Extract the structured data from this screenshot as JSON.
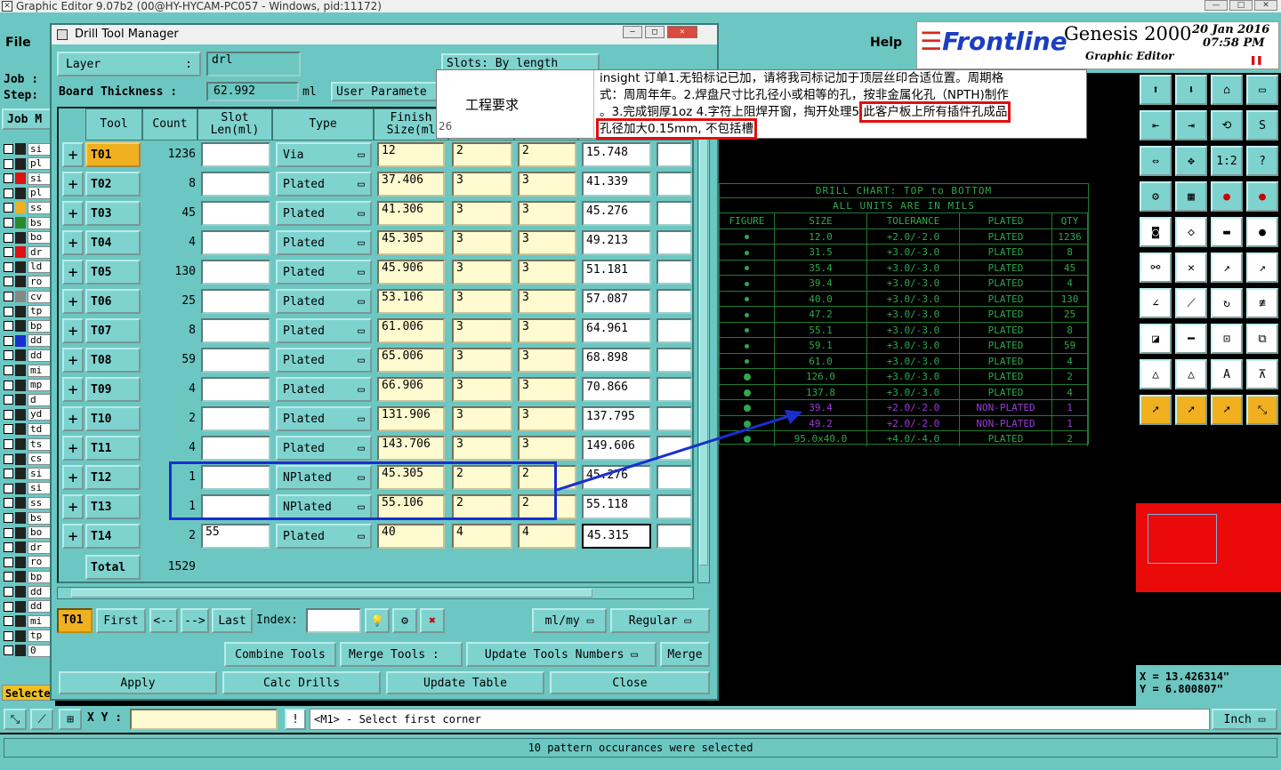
{
  "app": {
    "title": "Graphic Editor 9.07b2 (00@HY-HYCAM-PC057 - Windows, pid:11172)"
  },
  "menu": {
    "file": "File",
    "help": "Help"
  },
  "logo": {
    "brand": "Frontline",
    "product": "Genesis 2000",
    "date_line1": "20 Jan 2016",
    "date_line2": "07:58 PM",
    "subtitle": "Graphic Editor"
  },
  "left": {
    "job_label": "Job :",
    "step_label": "Step:",
    "job_matrix": "Job M",
    "selected": "Selecte",
    "layers": [
      "si",
      "pl",
      "si",
      "pl",
      "ss",
      "bs",
      "bo",
      "dr",
      "ld",
      "ro",
      "cv",
      "tp",
      "bp",
      "dd",
      "dd",
      "mi",
      "mp",
      "d",
      "yd",
      "td",
      "ts",
      "cs",
      "si",
      "si",
      "ss",
      "bs",
      "bo",
      "dr",
      "ro",
      "bp",
      "dd",
      "dd",
      "mi",
      "tp",
      "0"
    ]
  },
  "dialog": {
    "title": "Drill Tool Manager",
    "layer_label": "Layer",
    "layer_sep": ":",
    "layer_value": "drl",
    "slots_label": "Slots:",
    "slots_value": "By length",
    "board_thickness_label": "Board Thickness :",
    "board_thickness_value": "62.992",
    "board_thickness_unit": "ml",
    "user_params": "User Paramete",
    "headers": {
      "tool": "Tool",
      "count": "Count",
      "slot": "Slot\nLen(ml)",
      "type": "Type",
      "finish": "Finish\nSize(ml"
    },
    "rows": [
      {
        "tool": "T01",
        "count": "1236",
        "slot": "",
        "type": "Via",
        "finish": "12",
        "a": "2",
        "b": "2",
        "drill": "15.748"
      },
      {
        "tool": "T02",
        "count": "8",
        "slot": "",
        "type": "Plated",
        "finish": "37.406",
        "a": "3",
        "b": "3",
        "drill": "41.339"
      },
      {
        "tool": "T03",
        "count": "45",
        "slot": "",
        "type": "Plated",
        "finish": "41.306",
        "a": "3",
        "b": "3",
        "drill": "45.276"
      },
      {
        "tool": "T04",
        "count": "4",
        "slot": "",
        "type": "Plated",
        "finish": "45.305",
        "a": "3",
        "b": "3",
        "drill": "49.213"
      },
      {
        "tool": "T05",
        "count": "130",
        "slot": "",
        "type": "Plated",
        "finish": "45.906",
        "a": "3",
        "b": "3",
        "drill": "51.181"
      },
      {
        "tool": "T06",
        "count": "25",
        "slot": "",
        "type": "Plated",
        "finish": "53.106",
        "a": "3",
        "b": "3",
        "drill": "57.087"
      },
      {
        "tool": "T07",
        "count": "8",
        "slot": "",
        "type": "Plated",
        "finish": "61.006",
        "a": "3",
        "b": "3",
        "drill": "64.961"
      },
      {
        "tool": "T08",
        "count": "59",
        "slot": "",
        "type": "Plated",
        "finish": "65.006",
        "a": "3",
        "b": "3",
        "drill": "68.898"
      },
      {
        "tool": "T09",
        "count": "4",
        "slot": "",
        "type": "Plated",
        "finish": "66.906",
        "a": "3",
        "b": "3",
        "drill": "70.866"
      },
      {
        "tool": "T10",
        "count": "2",
        "slot": "",
        "type": "Plated",
        "finish": "131.906",
        "a": "3",
        "b": "3",
        "drill": "137.795"
      },
      {
        "tool": "T11",
        "count": "4",
        "slot": "",
        "type": "Plated",
        "finish": "143.706",
        "a": "3",
        "b": "3",
        "drill": "149.606"
      },
      {
        "tool": "T12",
        "count": "1",
        "slot": "",
        "type": "NPlated",
        "finish": "45.305",
        "a": "2",
        "b": "2",
        "drill": "45.276"
      },
      {
        "tool": "T13",
        "count": "1",
        "slot": "",
        "type": "NPlated",
        "finish": "55.106",
        "a": "2",
        "b": "2",
        "drill": "55.118"
      },
      {
        "tool": "T14",
        "count": "2",
        "slot": "55",
        "type": "Plated",
        "finish": "40",
        "a": "4",
        "b": "4",
        "drill": "45.315"
      }
    ],
    "total_label": "Total",
    "total_value": "1529",
    "nav": {
      "current": "T01",
      "first": "First",
      "prev": "<--",
      "next": "-->",
      "last": "Last",
      "index": "Index:",
      "units": "ml/my",
      "mode": "Regular"
    },
    "actions": {
      "combine": "Combine Tools",
      "merge_label": "Merge Tools :",
      "update_numbers": "Update Tools Numbers",
      "merge": "Merge",
      "apply": "Apply",
      "calc": "Calc Drills",
      "update_table": "Update Table",
      "close": "Close"
    }
  },
  "popup": {
    "line_no": "26",
    "label": "工程要求",
    "text1": "insight 订单1.无铅标记已加，请将我司标记加于顶层丝印合适位置。周期格",
    "text2": "式：周周年年。2.焊盘尺寸比孔径小或相等的孔，按非金属化孔（NPTH)制作",
    "text3a": "。3.完成铜厚1oz 4.字符上阻焊开窗，掏开处理5.",
    "text3b": "此客户板上所有插件孔成品",
    "text4": "孔径加大0.15mm, 不包括槽"
  },
  "drill_chart": {
    "title": "DRILL CHART: TOP to BOTTOM",
    "subtitle": "ALL UNITS ARE IN MILS",
    "headers": [
      "FIGURE",
      "SIZE",
      "TOLERANCE",
      "PLATED",
      "QTY"
    ],
    "rows": [
      [
        "12.0",
        "+2.0/-2.0",
        "PLATED",
        "1236"
      ],
      [
        "31.5",
        "+3.0/-3.0",
        "PLATED",
        "8"
      ],
      [
        "35.4",
        "+3.0/-3.0",
        "PLATED",
        "45"
      ],
      [
        "39.4",
        "+3.0/-3.0",
        "PLATED",
        "4"
      ],
      [
        "40.0",
        "+3.0/-3.0",
        "PLATED",
        "130"
      ],
      [
        "47.2",
        "+3.0/-3.0",
        "PLATED",
        "25"
      ],
      [
        "55.1",
        "+3.0/-3.0",
        "PLATED",
        "8"
      ],
      [
        "59.1",
        "+3.0/-3.0",
        "PLATED",
        "59"
      ],
      [
        "61.0",
        "+3.0/-3.0",
        "PLATED",
        "4"
      ],
      [
        "126.0",
        "+3.0/-3.0",
        "PLATED",
        "2"
      ],
      [
        "137.8",
        "+3.0/-3.0",
        "PLATED",
        "4"
      ],
      [
        "39.4",
        "+2.0/-2.0",
        "NON-PLATED",
        "1"
      ],
      [
        "49.2",
        "+2.0/-2.0",
        "NON-PLATED",
        "1"
      ],
      [
        "95.0x40.0",
        "+4.0/-4.0",
        "PLATED",
        "2"
      ]
    ]
  },
  "coords": {
    "x": "X  =  13.426314\"",
    "y": "Y  =  6.800807\""
  },
  "bottom": {
    "xy_label": "X Y :",
    "prompt": "<M1> - Select first corner",
    "units": "Inch",
    "status": "10 pattern occurances were selected"
  },
  "colors": {
    "teal": "#6cc7c2",
    "drill_green": "#2fa84a",
    "highlight_red": "#e01010",
    "highlight_blue": "#1a2ed0"
  }
}
